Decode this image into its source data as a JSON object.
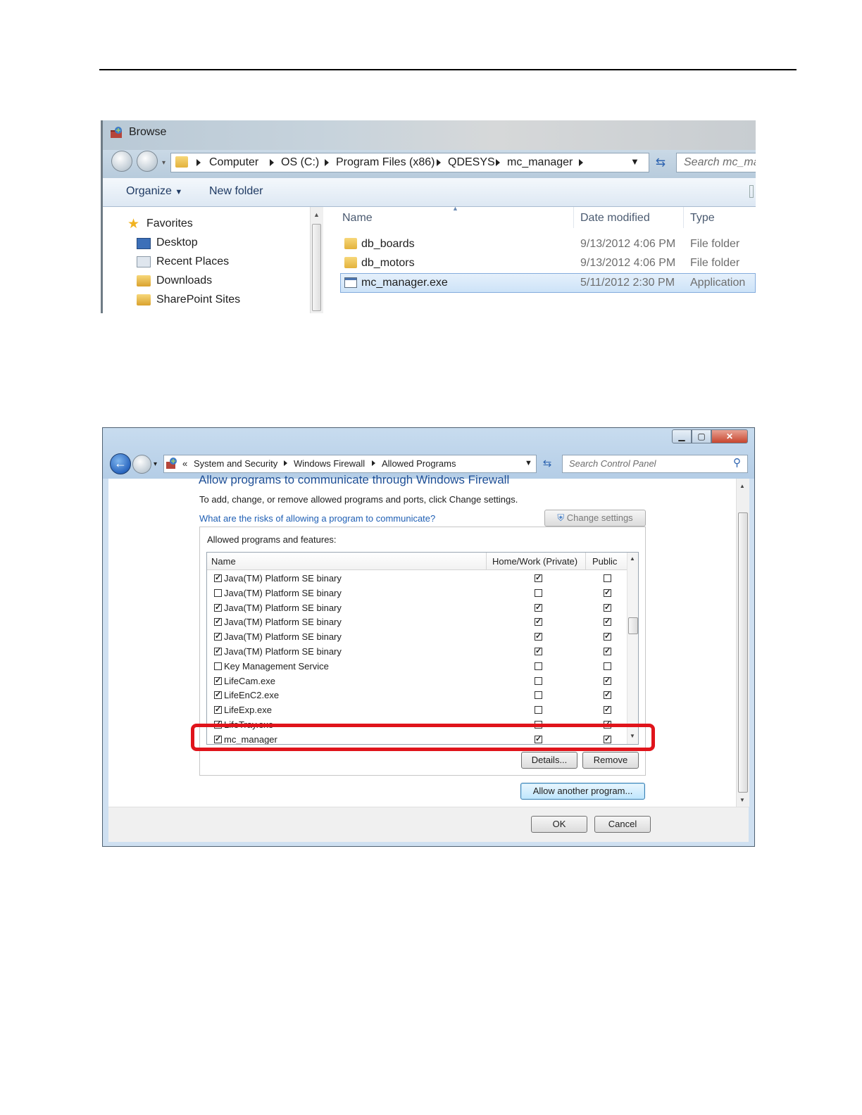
{
  "browse": {
    "title": "Browse",
    "breadcrumb": [
      "Computer",
      "OS (C:)",
      "Program Files (x86)",
      "QDESYS",
      "mc_manager"
    ],
    "search_placeholder": "Search mc_mar",
    "organize_label": "Organize",
    "new_folder_label": "New folder",
    "nav_items": [
      {
        "label": "Favorites",
        "icon": "star-icon"
      },
      {
        "label": "Desktop",
        "icon": "desktop-icon"
      },
      {
        "label": "Recent Places",
        "icon": "recent-places-icon"
      },
      {
        "label": "Downloads",
        "icon": "downloads-icon"
      },
      {
        "label": "SharePoint Sites",
        "icon": "sharepoint-icon"
      }
    ],
    "columns": [
      "Name",
      "Date modified",
      "Type"
    ],
    "files": [
      {
        "name": "db_boards",
        "date": "9/13/2012 4:06 PM",
        "type": "File folder",
        "icon": "folder-icon"
      },
      {
        "name": "db_motors",
        "date": "9/13/2012 4:06 PM",
        "type": "File folder",
        "icon": "folder-icon"
      },
      {
        "name": "mc_manager.exe",
        "date": "5/11/2012 2:30 PM",
        "type": "Application",
        "icon": "application-icon",
        "selected": true
      }
    ]
  },
  "firewall": {
    "breadcrumb": [
      "System and Security",
      "Windows Firewall",
      "Allowed Programs"
    ],
    "search_placeholder": "Search Control Panel",
    "heading": "Allow programs to communicate through Windows Firewall",
    "instructions": "To add, change, or remove allowed programs and ports, click Change settings.",
    "risks_link": "What are the risks of allowing a program to communicate?",
    "change_settings_label": "Change settings",
    "group_label": "Allowed programs and features:",
    "columns": [
      "Name",
      "Home/Work (Private)",
      "Public"
    ],
    "programs": [
      {
        "name": "Java(TM) Platform SE binary",
        "enabled": true,
        "private": true,
        "public": false
      },
      {
        "name": "Java(TM) Platform SE binary",
        "enabled": false,
        "private": false,
        "public": true
      },
      {
        "name": "Java(TM) Platform SE binary",
        "enabled": true,
        "private": true,
        "public": true
      },
      {
        "name": "Java(TM) Platform SE binary",
        "enabled": true,
        "private": true,
        "public": true
      },
      {
        "name": "Java(TM) Platform SE binary",
        "enabled": true,
        "private": true,
        "public": true
      },
      {
        "name": "Java(TM) Platform SE binary",
        "enabled": true,
        "private": true,
        "public": true
      },
      {
        "name": "Key Management Service",
        "enabled": false,
        "private": false,
        "public": false
      },
      {
        "name": "LifeCam.exe",
        "enabled": true,
        "private": false,
        "public": true
      },
      {
        "name": "LifeEnC2.exe",
        "enabled": true,
        "private": false,
        "public": true
      },
      {
        "name": "LifeExp.exe",
        "enabled": true,
        "private": false,
        "public": true
      },
      {
        "name": "LifeTray.exe",
        "enabled": true,
        "private": false,
        "public": true
      },
      {
        "name": "mc_manager",
        "enabled": true,
        "private": true,
        "public": true
      }
    ],
    "details_label": "Details...",
    "remove_label": "Remove",
    "allow_another_label": "Allow another program...",
    "ok_label": "OK",
    "cancel_label": "Cancel",
    "highlight_color": "#e0141b"
  }
}
